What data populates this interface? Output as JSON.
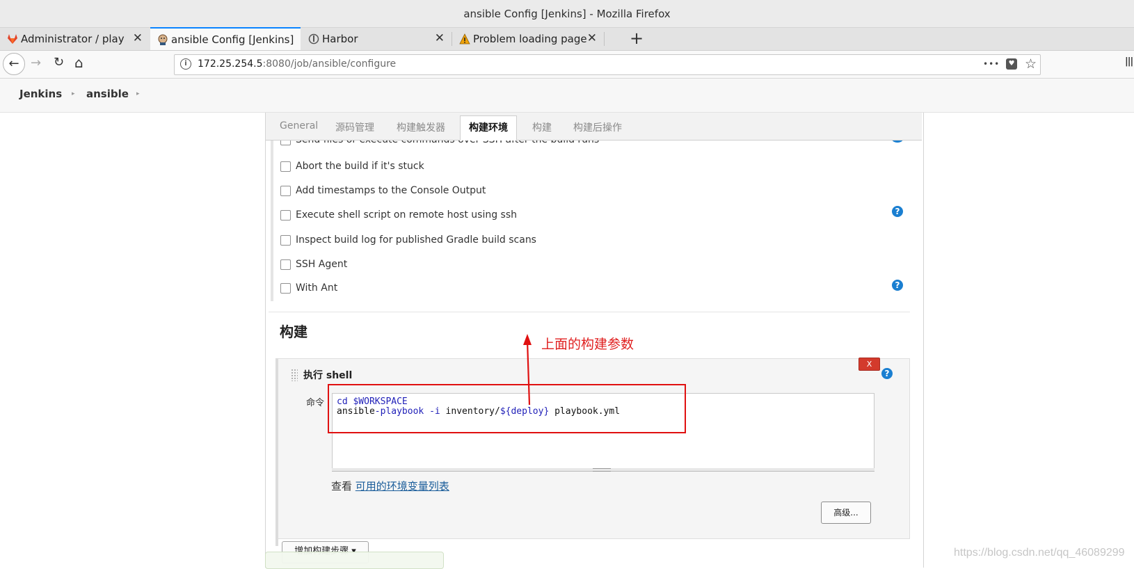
{
  "window": {
    "title": "ansible Config [Jenkins] - Mozilla Firefox"
  },
  "tabs": [
    {
      "label": "Administrator / playbook",
      "icon": "gitlab-icon"
    },
    {
      "label": "ansible Config [Jenkins]",
      "icon": "jenkins-icon"
    },
    {
      "label": "Harbor",
      "icon": "harbor-icon"
    },
    {
      "label": "Problem loading page",
      "icon": "warning-icon"
    }
  ],
  "tab_close": "✕",
  "new_tab": "+",
  "nav": {
    "back": "←",
    "forward": "→",
    "reload": "↻",
    "home": "⌂",
    "url_host": "172.25.254.5",
    "url_path": ":8080/job/ansible/configure",
    "more": "•••",
    "pocket": "♥",
    "bookmark": "☆",
    "library": "|||"
  },
  "breadcrumb": {
    "items": [
      "Jenkins",
      "ansible"
    ],
    "sep": "▸"
  },
  "config_tabs": [
    "General",
    "源码管理",
    "构建触发器",
    "构建环境",
    "构建",
    "构建后操作"
  ],
  "active_config_tab": "构建环境",
  "build_env_options": [
    "Send files or execute commands over SSH after the build runs",
    "Abort the build if it's stuck",
    "Add timestamps to the Console Output",
    "Execute shell script on remote host using ssh",
    "Inspect build log for published Gradle build scans",
    "SSH Agent",
    "With Ant"
  ],
  "help_glyph": "?",
  "build_section": {
    "title": "构建",
    "step_title": "执行 shell",
    "delete_label": "X",
    "command_label": "命令",
    "command_lines": [
      {
        "p1": "cd ",
        "p2": "$WORKSPACE",
        "p3": "",
        "p4": "",
        "p5": "",
        "p6": "",
        "p7": ""
      },
      {
        "p1": "ansible",
        "p2": "-playbook",
        "p3": " -i",
        "p4": " inventory/",
        "p5": "${deploy}",
        "p6": " playbook.yml",
        "p7": ""
      }
    ],
    "env_prefix": "查看 ",
    "env_link": "可用的环境变量列表",
    "advanced_button": "高级...",
    "add_step_button": "增加构建步骤 ▾"
  },
  "annotation": {
    "text": "上面的构建参数",
    "color": "#e02020"
  },
  "watermark": "https://blog.csdn.net/qq_46089299"
}
